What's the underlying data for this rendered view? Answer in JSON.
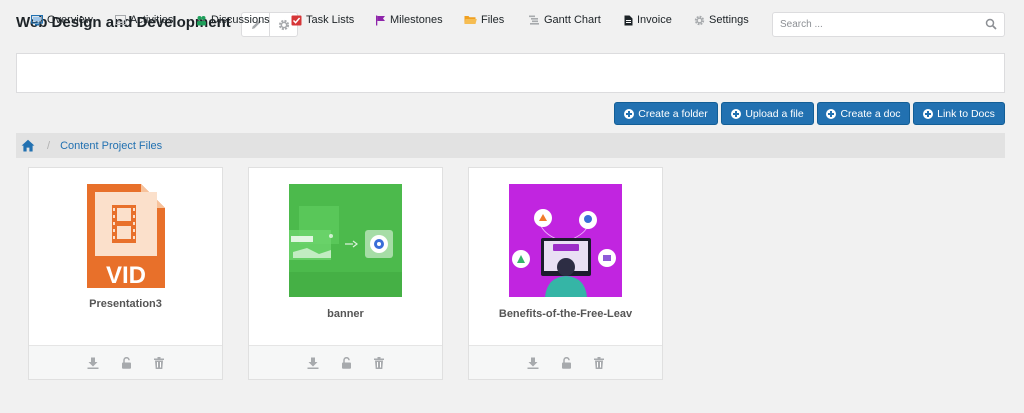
{
  "header": {
    "title": "Web Design and Development",
    "edit_icon": "pencil-icon",
    "settings_icon": "gear-icon"
  },
  "search": {
    "placeholder": "Search ...",
    "value": "",
    "icon": "search-icon"
  },
  "nav": {
    "items": [
      {
        "label": "Overview",
        "icon": "monitor-icon",
        "color": "#2271b1"
      },
      {
        "label": "Activities",
        "icon": "image-icon",
        "color": "#8c8f94"
      },
      {
        "label": "Discussions",
        "icon": "people-icon",
        "color": "#1e9e5a"
      },
      {
        "label": "Task Lists",
        "icon": "checkbox-icon",
        "color": "#d63638"
      },
      {
        "label": "Milestones",
        "icon": "flag-icon",
        "color": "#8e24aa"
      },
      {
        "label": "Files",
        "icon": "folder-icon",
        "color": "#f0a020"
      },
      {
        "label": "Gantt Chart",
        "icon": "gantt-icon",
        "color": "#8c8f94"
      },
      {
        "label": "Invoice",
        "icon": "document-icon",
        "color": "#1d2327"
      },
      {
        "label": "Settings",
        "icon": "gear-icon",
        "color": "#8c8f94"
      }
    ]
  },
  "actions": {
    "create_folder": "Create a folder",
    "upload_file": "Upload a file",
    "create_doc": "Create a doc",
    "link_docs": "Link to Docs"
  },
  "breadcrumb": {
    "home_icon": "home-icon",
    "current": "Content Project Files"
  },
  "files": [
    {
      "name": "Presentation3",
      "type": "video",
      "thumb_label": "VID"
    },
    {
      "name": "banner",
      "type": "image"
    },
    {
      "name": "Benefits-of-the-Free-Leav",
      "type": "image"
    }
  ],
  "file_actions": [
    "download-icon",
    "lock-icon",
    "trash-icon"
  ],
  "colors": {
    "primary": "#2271b1",
    "video_orange": "#e8702a",
    "banner_green": "#4cba4c",
    "benefits_purple": "#c125e0"
  }
}
